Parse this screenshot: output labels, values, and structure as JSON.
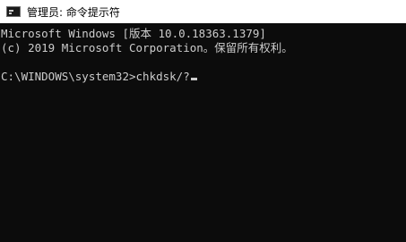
{
  "window": {
    "title": "管理员: 命令提示符",
    "icon": "console-app-icon"
  },
  "console": {
    "lines": [
      "Microsoft Windows [版本 10.0.18363.1379]",
      "(c) 2019 Microsoft Corporation。保留所有权利。",
      "",
      "C:\\WINDOWS\\system32>chkdsk/?"
    ]
  },
  "colors": {
    "background": "#0c0c0c",
    "text": "#cccccc",
    "titlebar": "#ffffff"
  }
}
